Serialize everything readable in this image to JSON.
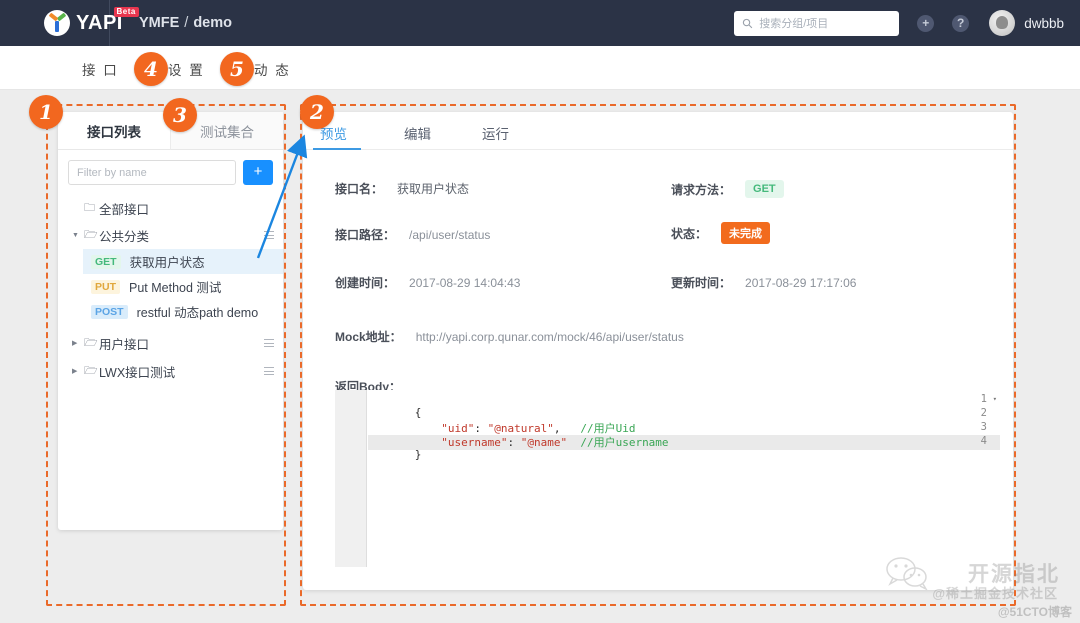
{
  "header": {
    "logo_text": "YAPI",
    "logo_badge": "Beta",
    "breadcrumb_group": "YMFE",
    "breadcrumb_sep": "/",
    "breadcrumb_project": "demo",
    "search_placeholder": "搜索分组/项目",
    "search_icon": "search-icon",
    "add_icon": "plus-circle-icon",
    "help_icon": "question-circle-icon",
    "username": "dwbbb",
    "bg_color": "#2b3346"
  },
  "nav": {
    "items": [
      {
        "label": "接 口"
      },
      {
        "label": "设 置"
      },
      {
        "label": "动 态"
      }
    ]
  },
  "sidebar": {
    "tabs": [
      {
        "label": "接口列表",
        "active": true
      },
      {
        "label": "测试集合",
        "active": false
      }
    ],
    "filter_placeholder": "Filter by name",
    "add_button_label": "+",
    "tree": [
      {
        "type": "folder",
        "label": "全部接口",
        "caret": false,
        "menu": false
      },
      {
        "type": "folder",
        "label": "公共分类",
        "caret": true,
        "expanded": true,
        "menu": true
      },
      {
        "type": "api",
        "method": "GET",
        "label": "获取用户状态",
        "selected": true
      },
      {
        "type": "api",
        "method": "PUT",
        "label": "Put Method 测试",
        "selected": false
      },
      {
        "type": "api",
        "method": "POST",
        "label": "restful 动态path demo",
        "selected": false
      },
      {
        "type": "folder",
        "label": "用户接口",
        "caret": true,
        "expanded": false,
        "menu": true
      },
      {
        "type": "folder",
        "label": "LWX接口测试",
        "caret": true,
        "expanded": false,
        "menu": true
      }
    ]
  },
  "content": {
    "tabs": [
      {
        "label": "预览",
        "active": true
      },
      {
        "label": "编辑",
        "active": false
      },
      {
        "label": "运行",
        "active": false
      }
    ],
    "fields": {
      "name_label": "接口名：",
      "name_value": "获取用户状态",
      "method_label": "请求方法：",
      "method_value": "GET",
      "path_label": "接口路径：",
      "path_value": "/api/user/status",
      "status_label": "状态：",
      "status_value": "未完成",
      "created_label": "创建时间：",
      "created_value": "2017-08-29 14:04:43",
      "updated_label": "更新时间：",
      "updated_value": "2017-08-29 17:17:06",
      "mock_label": "Mock地址：",
      "mock_value": "http://yapi.corp.qunar.com/mock/46/api/user/status",
      "body_label": "返回Body："
    },
    "editor": {
      "lines": [
        {
          "no": "1",
          "fold": "▾",
          "parts": [
            {
              "t": "{",
              "c": "tok-p"
            }
          ]
        },
        {
          "no": "2",
          "fold": "",
          "parts": [
            {
              "t": "    \"uid\"",
              "c": "tok-key"
            },
            {
              "t": ": ",
              "c": "tok-p"
            },
            {
              "t": "\"@natural\"",
              "c": "tok-str"
            },
            {
              "t": ",   ",
              "c": "tok-p"
            },
            {
              "t": "//用户Uid",
              "c": "tok-com"
            }
          ]
        },
        {
          "no": "3",
          "fold": "",
          "parts": [
            {
              "t": "    \"username\"",
              "c": "tok-key"
            },
            {
              "t": ": ",
              "c": "tok-p"
            },
            {
              "t": "\"@name\"",
              "c": "tok-str"
            },
            {
              "t": "  ",
              "c": "tok-p"
            },
            {
              "t": "//用户username",
              "c": "tok-com"
            }
          ]
        },
        {
          "no": "4",
          "fold": "",
          "parts": [
            {
              "t": "}",
              "c": "tok-p"
            }
          ]
        }
      ]
    }
  },
  "annotations": {
    "markers": [
      {
        "id": "1",
        "label": "1"
      },
      {
        "id": "2",
        "label": "2"
      },
      {
        "id": "3",
        "label": "3"
      },
      {
        "id": "4",
        "label": "4"
      },
      {
        "id": "5",
        "label": "5"
      }
    ],
    "dash_color": "#ea6a2a",
    "arrow_color": "#1b86e0"
  },
  "watermarks": {
    "main": "开源指北",
    "sub": "@稀土掘金技术社区",
    "cto": "@51CTO博客"
  }
}
